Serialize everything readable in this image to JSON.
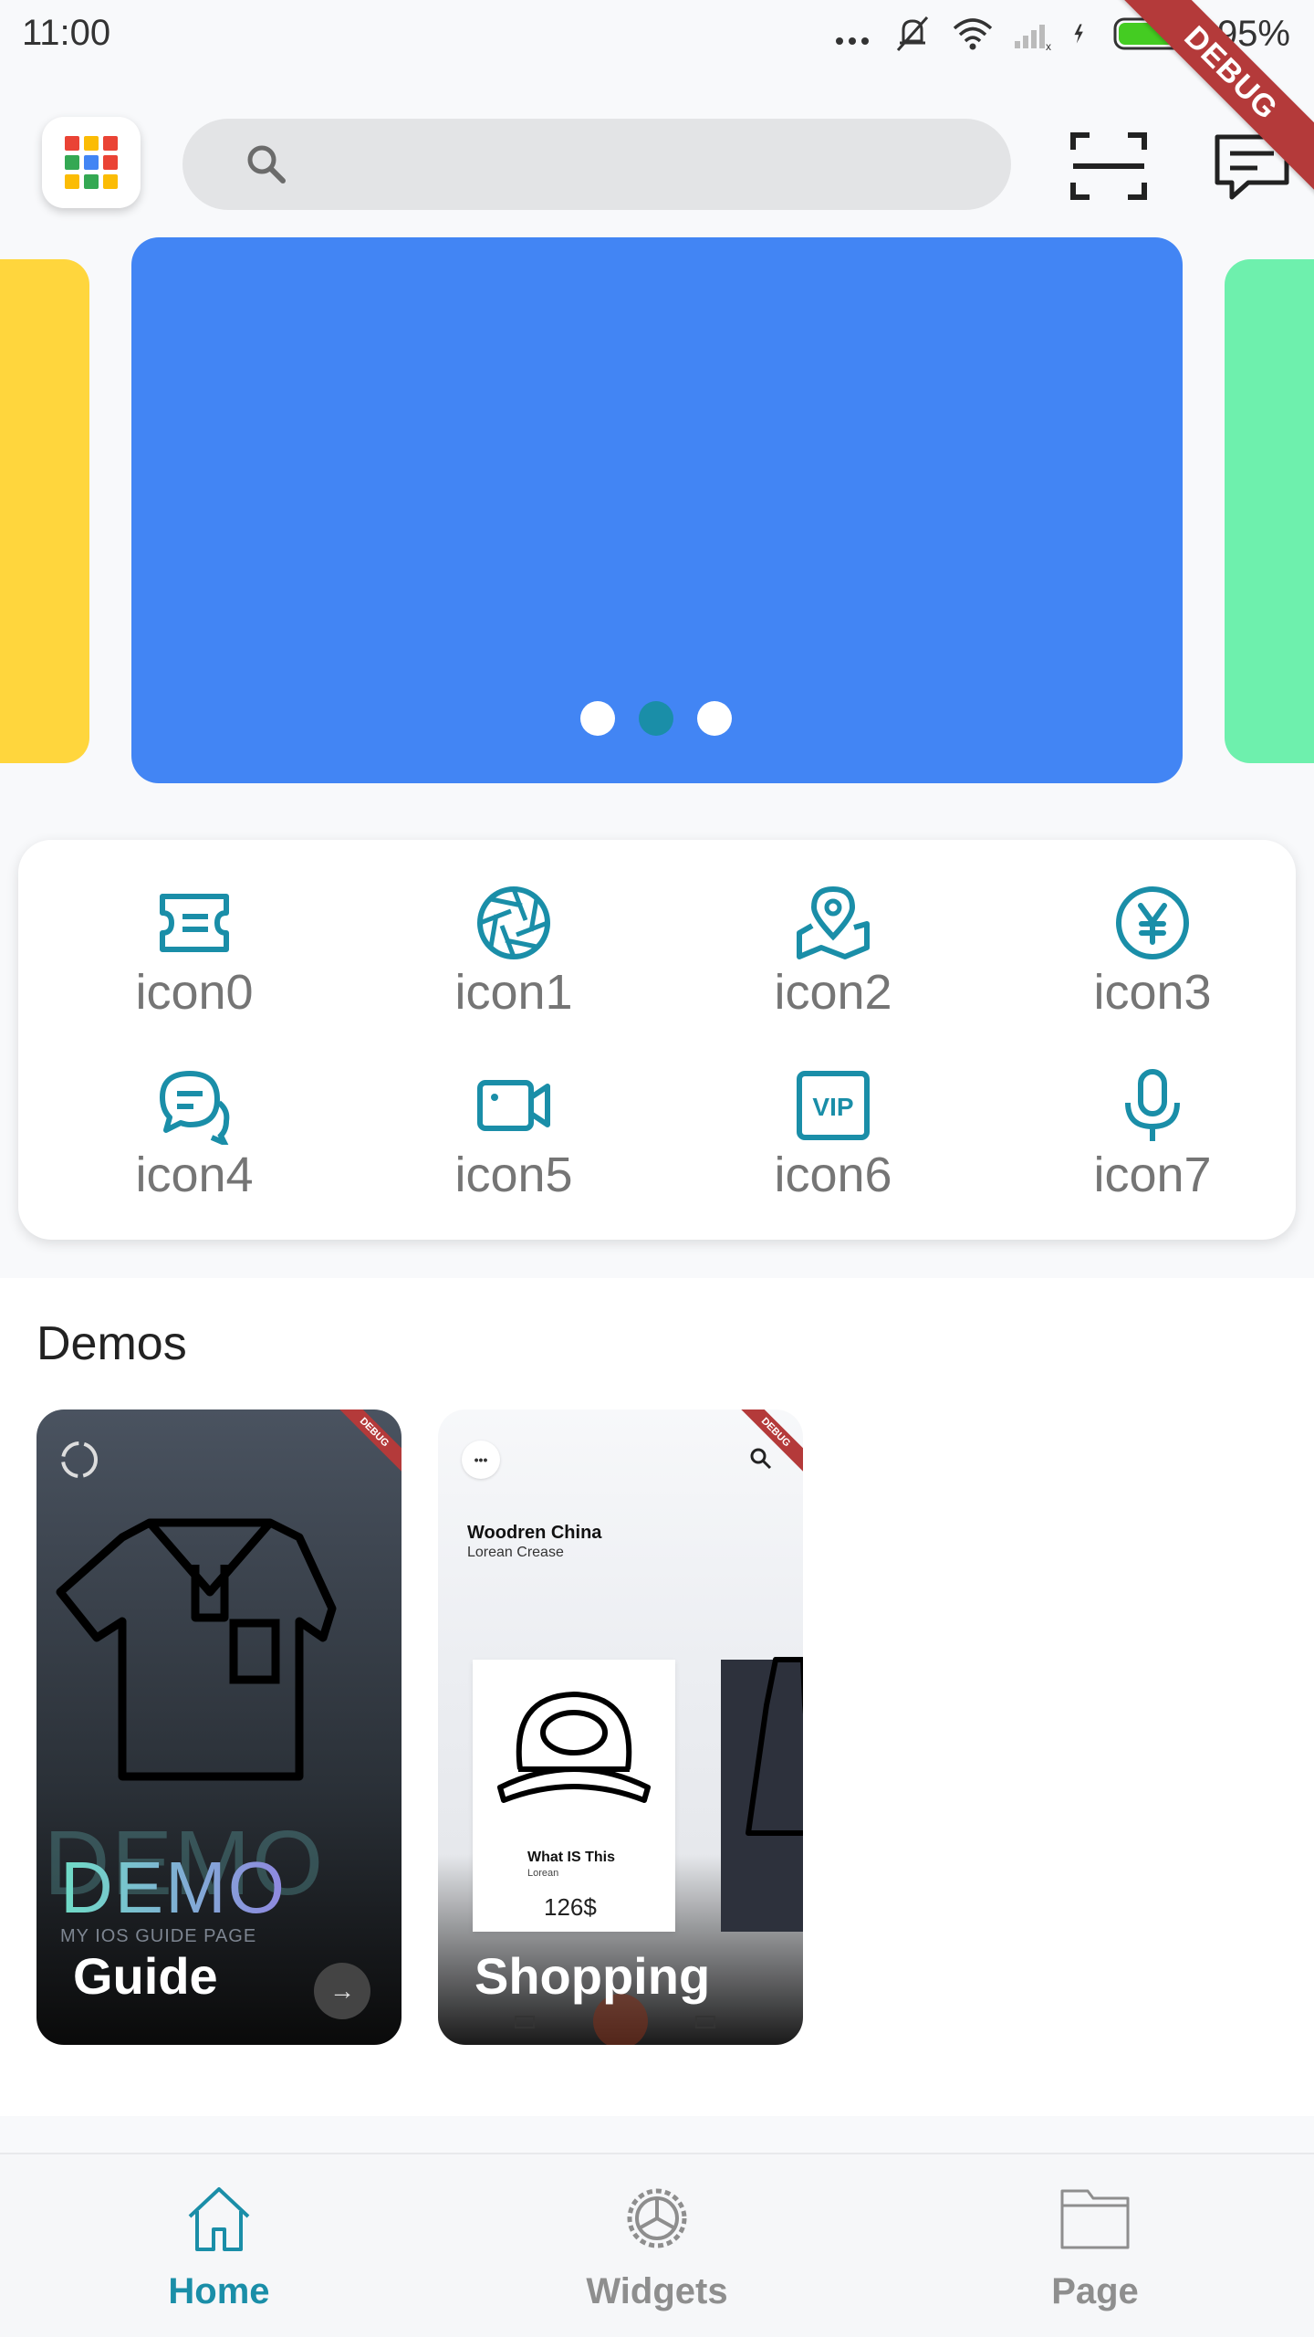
{
  "status_bar": {
    "time": "11:00",
    "battery": "95%"
  },
  "debug_banner": "DEBUG",
  "search": {
    "placeholder": ""
  },
  "carousel": {
    "slide_count": 3,
    "active_index": 1,
    "colors": [
      "#ffd63d",
      "#4285f4",
      "#6ef0ad"
    ]
  },
  "quick_grid": {
    "items": [
      {
        "label": "icon0",
        "icon": "ticket-icon"
      },
      {
        "label": "icon1",
        "icon": "aperture-icon"
      },
      {
        "label": "icon2",
        "icon": "map-pin-icon"
      },
      {
        "label": "icon3",
        "icon": "yen-icon"
      },
      {
        "label": "icon4",
        "icon": "chat-bubbles-icon"
      },
      {
        "label": "icon5",
        "icon": "video-camera-icon"
      },
      {
        "label": "icon6",
        "icon": "vip-icon"
      },
      {
        "label": "icon7",
        "icon": "microphone-icon"
      }
    ],
    "icon_color": "#1a8ea8"
  },
  "demos": {
    "title": "Demos",
    "cards": [
      {
        "title": "Guide",
        "brand_text": "DEMO",
        "brand_shadow": "DEMO",
        "subtitle": "MY IOS GUIDE PAGE",
        "arrow": "→",
        "mini_banner": "DEBUG"
      },
      {
        "title": "Shopping",
        "brand": "Woodren China",
        "brand_sub": "Lorean Crease",
        "product_name": "What IS This",
        "product_sub": "Lorean",
        "product_price": "126$",
        "mini_banner": "DEBUG"
      }
    ]
  },
  "bottom_nav": {
    "items": [
      {
        "label": "Home",
        "icon": "home-icon",
        "active": true
      },
      {
        "label": "Widgets",
        "icon": "gear-icon",
        "active": false
      },
      {
        "label": "Page",
        "icon": "folder-icon",
        "active": false
      }
    ],
    "active_color": "#1a8ea8",
    "inactive_color": "#8e8e8e"
  }
}
